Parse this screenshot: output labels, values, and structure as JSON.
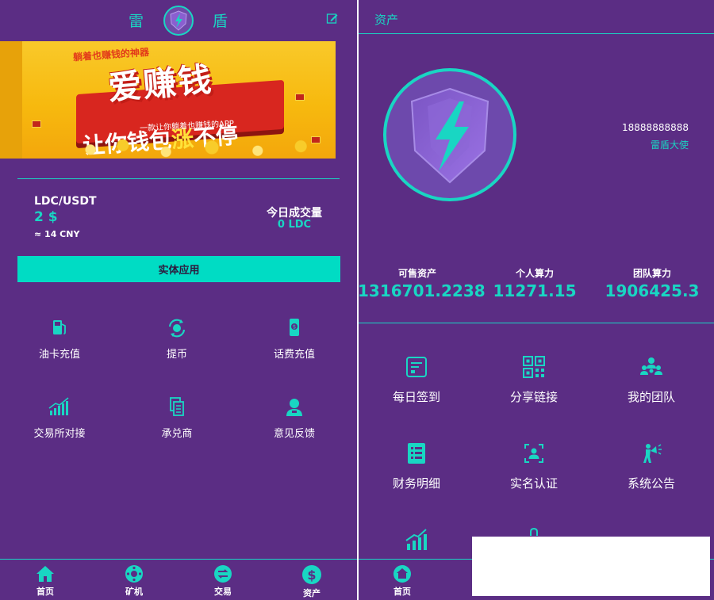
{
  "home": {
    "header": {
      "char_left": "雷",
      "char_right": "盾"
    },
    "banner": {
      "subtitle": "躺着也赚钱的神器",
      "title": "爱赚钱",
      "title2_prefix": "让你钱包",
      "title2_highlight": "涨",
      "title2_suffix": "不停",
      "tagline": "一款让你躺着也赚钱的APP"
    },
    "market": {
      "pair": "LDC/USDT",
      "price": "2 $",
      "cny": "≈ 14 CNY",
      "volume_label": "今日成交量",
      "volume_value": "0 LDC"
    },
    "apply_button": "实体应用",
    "grid": [
      {
        "label": "油卡充值",
        "icon": "gas-pump-icon"
      },
      {
        "label": "提币",
        "icon": "refresh-coin-icon"
      },
      {
        "label": "话费充值",
        "icon": "phone-recharge-icon"
      },
      {
        "label": "交易所对接",
        "icon": "chart-up-icon"
      },
      {
        "label": "承兑商",
        "icon": "documents-icon"
      },
      {
        "label": "意见反馈",
        "icon": "user-feedback-icon"
      }
    ],
    "nav": [
      {
        "label": "首页",
        "icon": "home-icon"
      },
      {
        "label": "矿机",
        "icon": "miner-icon"
      },
      {
        "label": "交易",
        "icon": "exchange-icon"
      },
      {
        "label": "资产",
        "icon": "dollar-icon"
      }
    ]
  },
  "assets": {
    "title": "资产",
    "phone": "18888888888",
    "role": "雷盾大使",
    "stats": [
      {
        "label": "可售资产",
        "value": "1316701.2238"
      },
      {
        "label": "个人算力",
        "value": "11271.15"
      },
      {
        "label": "团队算力",
        "value": "1906425.3"
      }
    ],
    "grid": [
      {
        "label": "每日签到",
        "icon": "checkin-icon"
      },
      {
        "label": "分享链接",
        "icon": "qrcode-icon"
      },
      {
        "label": "我的团队",
        "icon": "team-icon"
      },
      {
        "label": "财务明细",
        "icon": "ledger-icon"
      },
      {
        "label": "实名认证",
        "icon": "id-scan-icon"
      },
      {
        "label": "系统公告",
        "icon": "announcement-icon"
      }
    ],
    "nav_home": "首页"
  },
  "colors": {
    "background": "#5b2d84",
    "accent": "#19d6c3",
    "button": "#00dcc4"
  }
}
